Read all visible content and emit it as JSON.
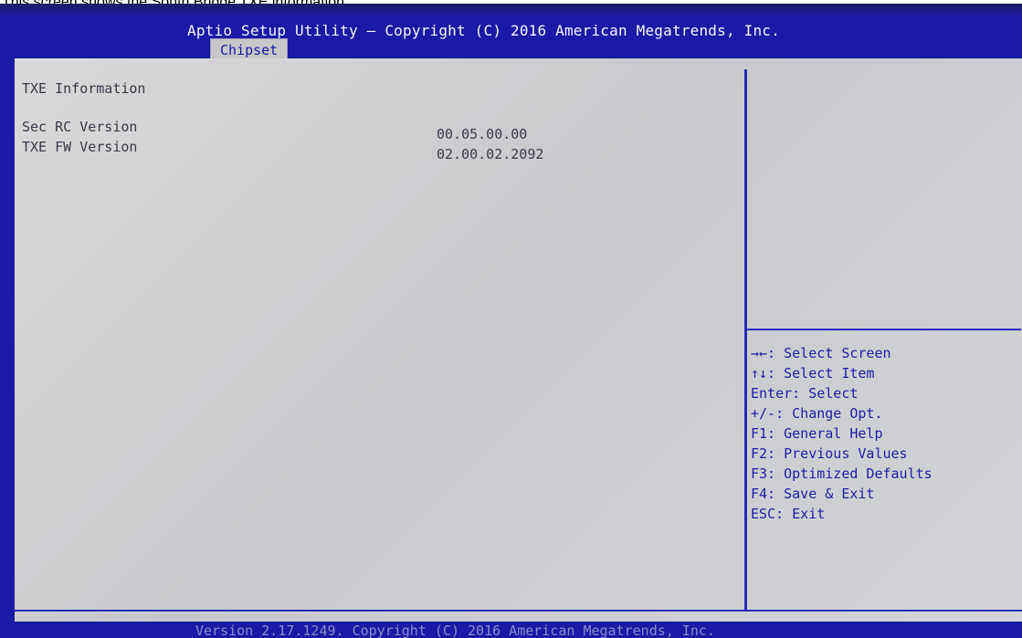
{
  "caption": "This screen shows the South Bridge TXE information.",
  "header": {
    "title": "Aptio Setup Utility – Copyright (C) 2016 American Megatrends, Inc.",
    "active_tab": "Chipset"
  },
  "main": {
    "section_title": "TXE Information",
    "rows": [
      {
        "label": "Sec RC Version",
        "value": "00.05.00.00"
      },
      {
        "label": "TXE FW Version",
        "value": "02.00.02.2092"
      }
    ]
  },
  "help": {
    "items": [
      "→←: Select Screen",
      "↑↓: Select Item",
      "Enter: Select",
      "+/-: Change Opt.",
      "F1: General Help",
      "F2: Previous Values",
      "F3: Optimized Defaults",
      "F4: Save & Exit",
      "ESC: Exit"
    ]
  },
  "footer": {
    "text": "Version 2.17.1249. Copyright (C) 2016 American Megatrends, Inc."
  },
  "colors": {
    "bios_blue": "#1a1aa6",
    "panel_gray": "#d0d1d4",
    "help_text": "#1e1ea6"
  }
}
